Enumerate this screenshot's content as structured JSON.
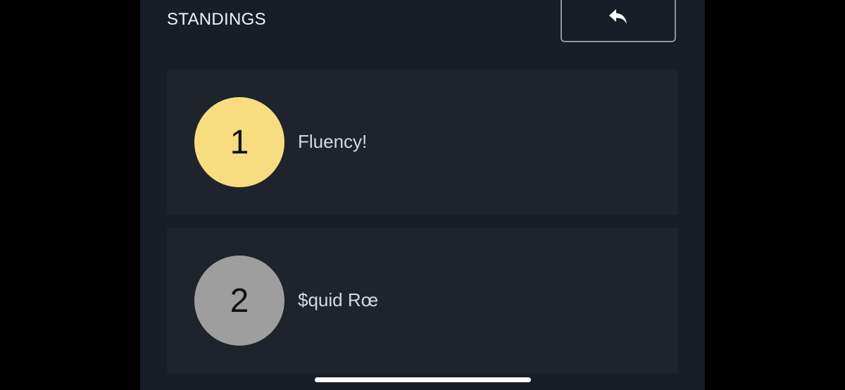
{
  "header": {
    "title": "STANDINGS",
    "back_icon": "reply-arrow-icon"
  },
  "standings": [
    {
      "rank": "1",
      "name": "Fluency!",
      "medal_color": "#f7dd80"
    },
    {
      "rank": "2",
      "name": "$quid Rœ",
      "medal_color": "#9e9e9e"
    }
  ],
  "colors": {
    "background": "#191d26",
    "card": "#1f232c",
    "text": "#d7d9dd"
  }
}
